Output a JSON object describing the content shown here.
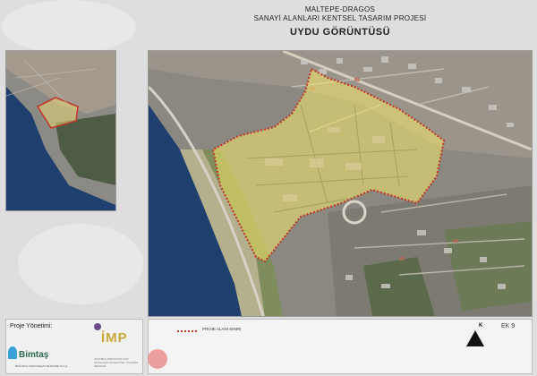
{
  "title": {
    "line1": "MALTEPE-DRAGOS",
    "line2": "SANAYİ ALANLARI KENTSEL TASARIM  PROJESİ",
    "line3": "UYDU GÖRÜNTÜSÜ"
  },
  "footer": {
    "management_label": "Proje Yönetimi:",
    "bimtas": "Bimtaş",
    "bimtas_sub": "BOĞAZİÇİ İMAR İNŞAAT MÜŞAVİRLİK A.Ş.",
    "imp": "İMP",
    "imp_sub": "İSTANBUL METROPOLİTAN PLANLAMA VE KENTSEL TASARIM MERKEZİ",
    "legend_text": "PROJE ALANI SINIRI",
    "sheet": "EK 9",
    "north": "K"
  },
  "colors": {
    "sea": "#1f3f6e",
    "boundary": "#c0392b",
    "project_fill": "#f6e96b"
  }
}
